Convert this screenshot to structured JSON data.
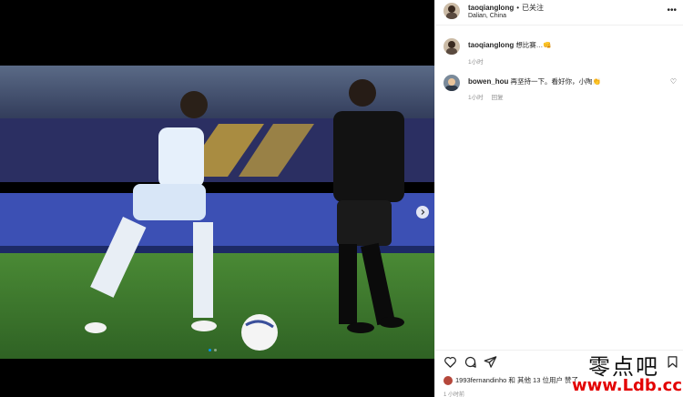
{
  "post": {
    "username": "taoqianglong",
    "separator": "•",
    "follow_status": "已关注",
    "location": "Dalian, China"
  },
  "comments": [
    {
      "username": "taoqianglong",
      "text": "想比赛…",
      "emoji": "👊",
      "time": "1小时",
      "reply": ""
    },
    {
      "username": "bowen_hou",
      "text": "再坚持一下。看好你，小陶",
      "emoji": "👏",
      "time": "1小时",
      "reply": "回复"
    }
  ],
  "likes": {
    "text_prefix": "1993fernandinho 和 其他 13 位用户 赞了"
  },
  "footer": {
    "time": "1 小时前"
  },
  "watermark": {
    "cn": "零点吧",
    "url": "www.Ldb.cc"
  },
  "icons": [
    "more-icon",
    "heart-icon",
    "comment-icon",
    "share-icon",
    "bookmark-icon",
    "chevron-right-icon"
  ],
  "colors": {
    "accent": "#0095f6",
    "watermark_red": "#e30000",
    "pitch_green": "#3f7a2d"
  }
}
